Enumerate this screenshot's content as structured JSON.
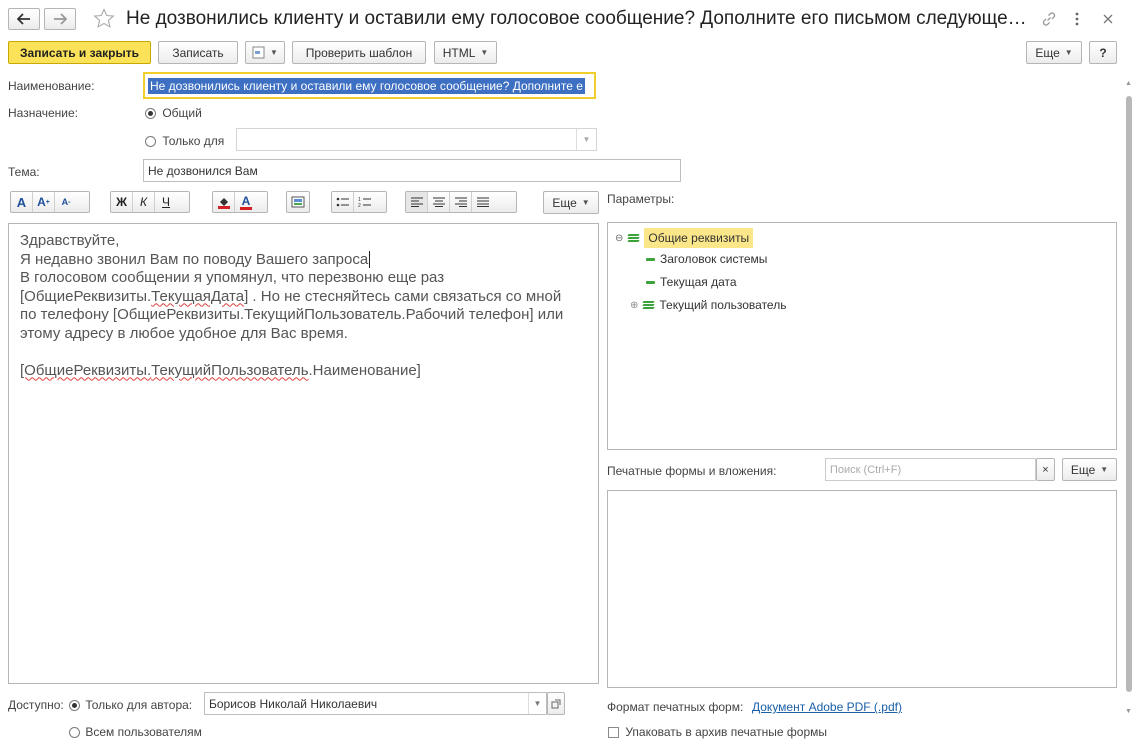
{
  "window": {
    "title": "Не дозвонились клиенту и оставили ему голосовое сообщение? Дополните его письмом следующе…",
    "back_icon": "arrow-left-icon",
    "forward_icon": "arrow-right-icon",
    "star_icon": "star-outline-icon",
    "link_icon": "link-icon",
    "more_icon": "vertical-dots-icon",
    "close_icon": "close-icon"
  },
  "toolbar": {
    "save_close": "Записать и закрыть",
    "save": "Записать",
    "check_template": "Проверить шаблон",
    "html": "HTML",
    "more": "Еще",
    "help": "?"
  },
  "form": {
    "name_label": "Наименование:",
    "name_value": "Не дозвонились клиенту и оставили ему голосовое сообщение? Дополните е",
    "purpose_label": "Назначение:",
    "purpose_common": "Общий",
    "purpose_only": "Только для",
    "subject_label": "Тема:",
    "subject_value": "Не дозвонился Вам"
  },
  "editor": {
    "more": "Еще",
    "lines": {
      "l1": "Здравствуйте,",
      "l2": "Я недавно звонил Вам по поводу Вашего запроса",
      "l3": "В голосовом сообщении я упомянул, что перезвоню еще раз",
      "l4a": "[ОбщиеРеквизиты.",
      "l4b": "ТекущаяДата",
      "l4c": "] . Но не стесняйтесь сами связаться со мной",
      "l5a": "по телефону [ОбщиеРеквизиты.",
      "l5b": "ТекущийПользователь",
      "l5c": ".Рабочий телефон]  или",
      "l6": "этому адресу в любое удобное для Вас время.",
      "l8a": "[ОбщиеРеквизиты.",
      "l8b": "ТекущийПользователь",
      "l8c": ".Наименование]"
    }
  },
  "params": {
    "label": "Параметры:",
    "root": "Общие реквизиты",
    "items": [
      "Заголовок системы",
      "Текущая дата",
      "Текущий пользователь"
    ]
  },
  "print_forms": {
    "label": "Печатные формы и вложения:",
    "search_placeholder": "Поиск (Ctrl+F)",
    "more": "Еще",
    "format_label": "Формат печатных форм:",
    "format_value": "Документ Adobe PDF (.pdf)",
    "archive_label": "Упаковать в архив печатные формы"
  },
  "access": {
    "label": "Доступно:",
    "author_only": "Только для автора:",
    "author_value": "Борисов Николай Николаевич",
    "all_users": "Всем пользователям"
  },
  "colors": {
    "accent_yellow": "#fbe258",
    "selection_blue": "#3d6fc2",
    "tree_green": "#3ca33c",
    "link_blue": "#1a5fa8"
  }
}
